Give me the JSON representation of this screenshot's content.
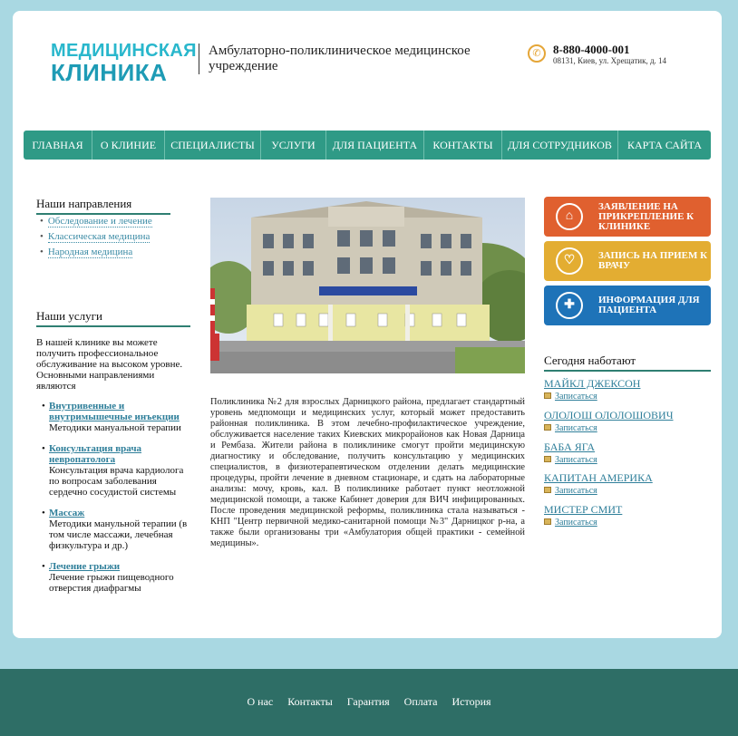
{
  "header": {
    "logo_top": "МЕДИЦИНСКАЯ",
    "logo_bottom": "КЛИНИКА",
    "tagline": "Амбулаторно-поликлиническое медицинское учреждение",
    "phone": "8-880-4000-001",
    "address": "08131, Киев, ул. Хрещатик, д. 14"
  },
  "nav": [
    {
      "label": "ГЛАВНАЯ"
    },
    {
      "label": "О КЛИНИЕ"
    },
    {
      "label": "СПЕЦИАЛИСТЫ"
    },
    {
      "label": "УСЛУГИ"
    },
    {
      "label": "ДЛЯ ПАЦИЕНТА"
    },
    {
      "label": "КОНТАКТЫ"
    },
    {
      "label": "ДЛЯ СОТРУДНИКОВ"
    },
    {
      "label": "КАРТА САЙТА"
    }
  ],
  "directions": {
    "title": "Наши направления",
    "items": [
      "Обследование и лечение",
      "Классическая медицина",
      "Народная медицина"
    ]
  },
  "services": {
    "title": "Наши услуги",
    "intro": "В нашей клинике вы можете получить профессиональное обслуживание на высоком уровне. Основными направлениями являются",
    "items": [
      {
        "title": "Внутривенные и внутримышечные инъекции",
        "desc": "Методики мануальной терапии"
      },
      {
        "title": "Консультация врача невропатолога",
        "desc": "Консультация врача кардиолога по вопросам заболевания сердечно сосудистой системы"
      },
      {
        "title": "Массаж",
        "desc": "Методики манульной терапии (в том числе массажи, лечебная физкультура и др.)"
      },
      {
        "title": "Лечение грыжи",
        "desc": "Лечение грыжи пищеводного отверстия диафрагмы"
      }
    ]
  },
  "article": "Поликлиника №2 для взрослых Дарницкого района, предлагает стандартный уровень медпомощи и медицинских услуг, который может предоставить районная поликлиника. В этом лечебно-профилактическое учреждение, обслуживается население таких Киевских микрорайонов как Новая Дарница и Рембаза. Жители района в поликлинике смогут пройти медицинскую диагностику и обследование, получить консультацию у медицинских специалистов, в физиотерапевтическом отделении делать медицинские процедуры, пройти лечение в дневном стационаре, и сдать на лабораторные анализы: мочу, кровь, кал. В поликлинике работает пункт неотложной медицинской помощи, а также Кабинет доверия для ВИЧ инфицированных. После проведения медицинской реформы, поликлиника стала называться - КНП \"Центр первичной медико-санитарной помощи №3\" Дарницког р-на, а также были организованы три «Амбулатория общей практики - семейной медицины».",
  "cta": [
    {
      "label": "ЗАЯВЛЕНИЕ НА ПРИКРЕПЛЕНИЕ К КЛИНИКЕ",
      "color": "#e0602f",
      "icon": "house-plus-icon"
    },
    {
      "label": "ЗАПИСЬ НА ПРИЕМ К ВРАЧУ",
      "color": "#e3ad32",
      "icon": "heart-icon"
    },
    {
      "label": "ИНФОРМАЦИЯ ДЛЯ ПАЦИЕНТА",
      "color": "#1e73b8",
      "icon": "medical-folder-icon"
    }
  ],
  "today": {
    "title": "Сегодня наботают",
    "doctors": [
      {
        "name": "МАЙКЛ ДЖЕКСОН",
        "action": "Записаться"
      },
      {
        "name": "ОЛОЛОШ ОЛОЛОШОВИЧ",
        "action": "Записаться"
      },
      {
        "name": "БАБА ЯГА",
        "action": "Записаться"
      },
      {
        "name": "КАПИТАН АМЕРИКА",
        "action": "Записаться"
      },
      {
        "name": "МИСТЕР СМИТ",
        "action": "Записаться"
      }
    ]
  },
  "footer": {
    "links": [
      "О нас",
      "Контакты",
      "Гарантия",
      "Оплата",
      "История"
    ]
  }
}
